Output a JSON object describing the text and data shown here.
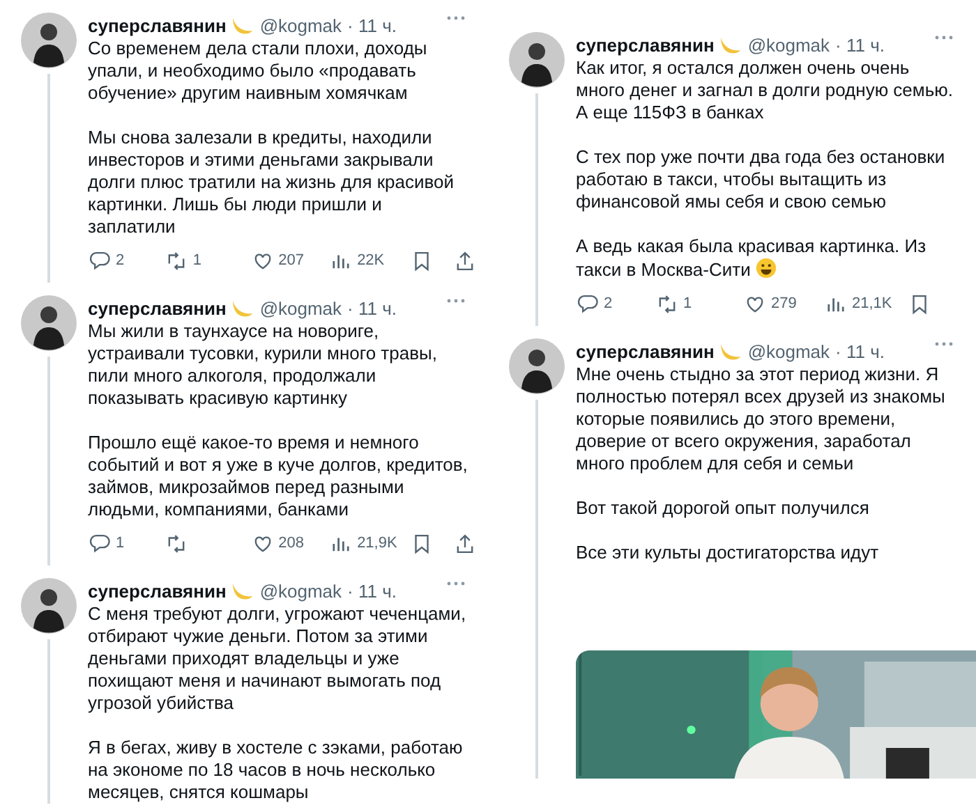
{
  "columns": [
    {
      "tweets": [
        {
          "author": "суперславянин",
          "handle": "@kogmak",
          "time": "· 11 ч.",
          "paragraphs": [
            {
              "text": "Со временем дела стали плохи, доходы\nупали, и необходимо было «продавать\nобучение» другим наивным хомячкам"
            },
            {
              "text": "Мы снова залезали в кредиты, находили\nинвесторов и этими деньгами закрывали\nдолги плюс тратили на жизнь для красивой\nкартинки. Лишь бы люди пришли и\nзаплатили"
            }
          ],
          "actions": [
            {
              "kind": "reply",
              "count": "2"
            },
            {
              "kind": "retweet",
              "count": "1"
            },
            {
              "kind": "like",
              "count": "207"
            },
            {
              "kind": "views",
              "count": "22K"
            },
            {
              "kind": "bookmark"
            },
            {
              "kind": "share"
            }
          ]
        },
        {
          "author": "суперславянин",
          "handle": "@kogmak",
          "time": "· 11 ч.",
          "paragraphs": [
            {
              "text": "Мы жили в таунхаусе на новориге,\nустраивали тусовки, курили много травы,\nпили много алкоголя, продолжали\nпоказывать красивую картинку"
            },
            {
              "text": "Прошло ещё какое-то время и немного\nсобытий и вот я уже в куче долгов, кредитов,\nзаймов, микрозаймов перед разными\nлюдьми, компаниями, банками"
            }
          ],
          "actions": [
            {
              "kind": "reply",
              "count": "1"
            },
            {
              "kind": "retweet"
            },
            {
              "kind": "like",
              "count": "208"
            },
            {
              "kind": "views",
              "count": "21,9K"
            },
            {
              "kind": "bookmark"
            },
            {
              "kind": "share"
            }
          ]
        },
        {
          "author": "суперславянин",
          "handle": "@kogmak",
          "time": "· 11 ч.",
          "paragraphs": [
            {
              "text": "С меня требуют долги, угрожают чеченцами,\nотбирают чужие деньги. Потом за этими\nденьгами приходят владельцы и уже\nпохищают меня и начинают вымогать под\nугрозой убийства"
            },
            {
              "text": "Я в бегах, живу в хостеле с зэками, работаю\nна экономе по 18 часов в ночь несколько\nмесяцев, снятся кошмары"
            }
          ]
        }
      ]
    },
    {
      "tweets": [
        {
          "author": "суперславянин",
          "handle": "@kogmak",
          "time": "· 11 ч.",
          "paragraphs": [
            {
              "text": "Как итог, я остался должен очень очень\nмного денег и загнал в долги родную семью.\nА еще 115ФЗ в банках"
            },
            {
              "text": "С тех пор уже почти два года без остановки\nработаю в такси, чтобы вытащить из\nфинансовой ямы себя и свою семью"
            },
            {
              "text": "А ведь какая была красивая картинка. Из\nтакси в Москва-Сити",
              "kind": "smiley-end"
            }
          ],
          "actions": [
            {
              "kind": "reply",
              "count": "2"
            },
            {
              "kind": "retweet",
              "count": "1"
            },
            {
              "kind": "like",
              "count": "279"
            },
            {
              "kind": "views",
              "count": "21,1K"
            },
            {
              "kind": "bookmark"
            }
          ]
        },
        {
          "author": "суперславянин",
          "handle": "@kogmak",
          "time": "· 11 ч.",
          "paragraphs": [
            {
              "text": "Мне очень стыдно за этот период жизни. Я\nполностью потерял всех друзей из знакомы\nкоторые появились до этого времени,\nдоверие от всего окружения, заработал\nмного проблем для себя и семьи"
            },
            {
              "text": "Вот такой дорогой опыт получился"
            },
            {
              "text": "Все эти культы достигаторства идут"
            }
          ]
        }
      ]
    }
  ]
}
